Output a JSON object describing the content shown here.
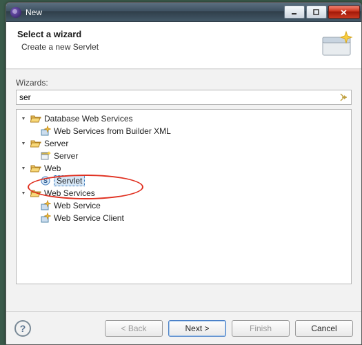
{
  "window": {
    "title": "New"
  },
  "banner": {
    "title": "Select a wizard",
    "subtitle": "Create a new Servlet"
  },
  "filter": {
    "label": "Wizards:",
    "value": "ser"
  },
  "tree": [
    {
      "level": 0,
      "expanded": true,
      "icon": "folder-open",
      "label": "Database Web Services"
    },
    {
      "level": 1,
      "icon": "wizard-ws",
      "label": "Web Services from Builder XML"
    },
    {
      "level": 0,
      "expanded": true,
      "icon": "folder-open",
      "label": "Server"
    },
    {
      "level": 1,
      "icon": "server",
      "label": "Server"
    },
    {
      "level": 0,
      "expanded": true,
      "icon": "folder-open",
      "label": "Web"
    },
    {
      "level": 1,
      "icon": "servlet",
      "label": "Servlet",
      "selected": true
    },
    {
      "level": 0,
      "expanded": true,
      "icon": "folder-open",
      "label": "Web Services"
    },
    {
      "level": 1,
      "icon": "wizard-ws",
      "label": "Web Service"
    },
    {
      "level": 1,
      "icon": "wizard-ws",
      "label": "Web Service Client"
    }
  ],
  "buttons": {
    "back": "< Back",
    "next": "Next >",
    "finish": "Finish",
    "cancel": "Cancel"
  }
}
